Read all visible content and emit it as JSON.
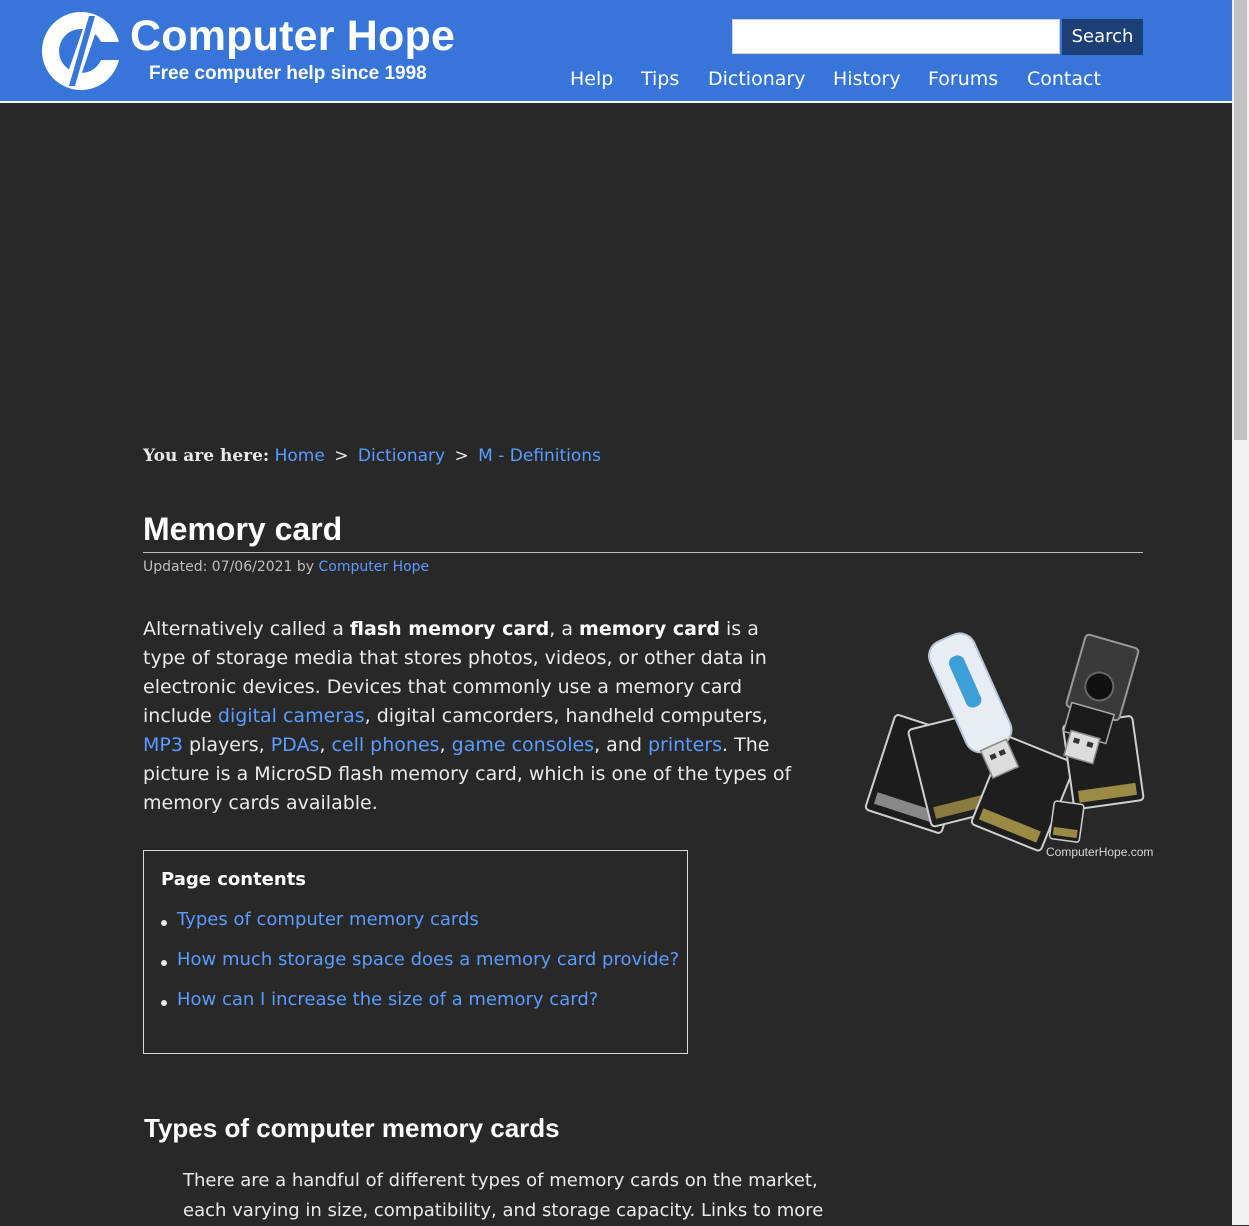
{
  "header": {
    "logo_title": "Computer Hope",
    "logo_tagline": "Free computer help since 1998",
    "search_placeholder": "",
    "search_label": "Search",
    "colors": {
      "bar": "#3775d9",
      "search_button": "#1d3f78"
    },
    "nav": [
      {
        "label": "Help"
      },
      {
        "label": "Tips"
      },
      {
        "label": "Dictionary"
      },
      {
        "label": "History"
      },
      {
        "label": "Forums"
      },
      {
        "label": "Contact"
      }
    ]
  },
  "breadcrumb": {
    "label": "You are here:",
    "items": [
      "Home",
      "Dictionary",
      "M - Definitions"
    ],
    "separator": ">"
  },
  "article": {
    "title": "Memory card",
    "updated_prefix": "Updated: 07/06/2021 by",
    "author": "Computer Hope",
    "intro": {
      "t1": "Alternatively called a ",
      "b1": "flash memory card",
      "t2": ", a ",
      "b2": "memory card",
      "t3": " is a type of storage media that stores photos, videos, or other data in electronic devices. Devices that commonly use a memory card include ",
      "l1": "digital cameras",
      "t4": ", digital camcorders, handheld computers, ",
      "l2": "MP3",
      "t5": " players, ",
      "l3": "PDAs",
      "t6": ", ",
      "l4": "cell phones",
      "t7": ", ",
      "l5": "game consoles",
      "t8": ", and ",
      "l6": "printers",
      "t9": ". The picture is a MicroSD flash memory card, which is one of the types of memory cards available."
    },
    "figure_caption": "ComputerHope.com",
    "figure_icon": "memory-cards-and-usb-drives-image",
    "toc": {
      "title": "Page contents",
      "items": [
        "Types of computer memory cards",
        "How much storage space does a memory card provide?",
        "How can I increase the size of a memory card?"
      ]
    },
    "section": {
      "heading": "Types of computer memory cards",
      "text": "There are a handful of different types of memory cards on the market, each varying in size, compatibility, and storage capacity. Links to more"
    }
  },
  "theme": {
    "background": "#282828",
    "link": "#5a9cff",
    "text": "#e8e8e8"
  }
}
